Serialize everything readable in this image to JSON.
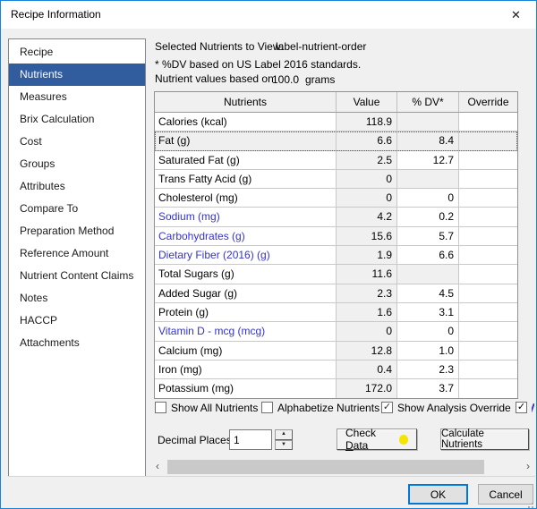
{
  "window": {
    "title": "Recipe Information"
  },
  "icons": {
    "close": "✕",
    "spinner_up": "▲",
    "spinner_down": "▼",
    "scroll_left": "‹",
    "scroll_right": "›",
    "check": "✓"
  },
  "colors": {
    "accent": "#0078d7",
    "sidebar_selection": "#315c9e",
    "nutrient_link_blue": "#3333cc",
    "check_data_dot": "#f5e400",
    "dialog_bg": "#f0f0f0"
  },
  "sidebar": {
    "items": [
      {
        "label": "Recipe",
        "selected": false
      },
      {
        "label": "Nutrients",
        "selected": true
      },
      {
        "label": "Measures",
        "selected": false
      },
      {
        "label": "Brix Calculation",
        "selected": false
      },
      {
        "label": "Cost",
        "selected": false
      },
      {
        "label": "Groups",
        "selected": false
      },
      {
        "label": "Attributes",
        "selected": false
      },
      {
        "label": "Compare To",
        "selected": false
      },
      {
        "label": "Preparation Method",
        "selected": false
      },
      {
        "label": "Reference Amount",
        "selected": false
      },
      {
        "label": "Nutrient Content Claims",
        "selected": false
      },
      {
        "label": "Notes",
        "selected": false
      },
      {
        "label": "HACCP",
        "selected": false
      },
      {
        "label": "Attachments",
        "selected": false
      }
    ]
  },
  "info": {
    "selected_nutrients_label": "Selected Nutrients to View:",
    "selected_nutrients_value": "label-nutrient-order",
    "dv_note": "* %DV based on US Label 2016 standards.",
    "basis_label": "Nutrient values based on",
    "basis_value": "100.0",
    "basis_unit": "grams"
  },
  "table": {
    "columns": [
      "Nutrients",
      "Value",
      "% DV*",
      "Override"
    ],
    "rows": [
      {
        "name": "Calories (kcal)",
        "value": "118.9",
        "dv": "",
        "override": "",
        "blue": false,
        "dv_na": true,
        "focused": false
      },
      {
        "name": "Fat (g)",
        "value": "6.6",
        "dv": "8.4",
        "override": "",
        "blue": false,
        "dv_na": false,
        "focused": true
      },
      {
        "name": "Saturated Fat (g)",
        "value": "2.5",
        "dv": "12.7",
        "override": "",
        "blue": false,
        "dv_na": false,
        "focused": false
      },
      {
        "name": "Trans Fatty Acid (g)",
        "value": "0",
        "dv": "",
        "override": "",
        "blue": false,
        "dv_na": true,
        "focused": false
      },
      {
        "name": "Cholesterol (mg)",
        "value": "0",
        "dv": "0",
        "override": "",
        "blue": false,
        "dv_na": false,
        "focused": false
      },
      {
        "name": "Sodium (mg)",
        "value": "4.2",
        "dv": "0.2",
        "override": "",
        "blue": true,
        "dv_na": false,
        "focused": false
      },
      {
        "name": "Carbohydrates (g)",
        "value": "15.6",
        "dv": "5.7",
        "override": "",
        "blue": true,
        "dv_na": false,
        "focused": false
      },
      {
        "name": "Dietary Fiber (2016) (g)",
        "value": "1.9",
        "dv": "6.6",
        "override": "",
        "blue": true,
        "dv_na": false,
        "focused": false
      },
      {
        "name": "Total Sugars (g)",
        "value": "11.6",
        "dv": "",
        "override": "",
        "blue": false,
        "dv_na": true,
        "focused": false
      },
      {
        "name": "Added Sugar (g)",
        "value": "2.3",
        "dv": "4.5",
        "override": "",
        "blue": false,
        "dv_na": false,
        "focused": false
      },
      {
        "name": "Protein (g)",
        "value": "1.6",
        "dv": "3.1",
        "override": "",
        "blue": false,
        "dv_na": false,
        "focused": false
      },
      {
        "name": "Vitamin D - mcg (mcg)",
        "value": "0",
        "dv": "0",
        "override": "",
        "blue": true,
        "dv_na": false,
        "focused": false
      },
      {
        "name": "Calcium (mg)",
        "value": "12.8",
        "dv": "1.0",
        "override": "",
        "blue": false,
        "dv_na": false,
        "focused": false
      },
      {
        "name": "Iron (mg)",
        "value": "0.4",
        "dv": "2.3",
        "override": "",
        "blue": false,
        "dv_na": false,
        "focused": false
      },
      {
        "name": "Potassium (mg)",
        "value": "172.0",
        "dv": "3.7",
        "override": "",
        "blue": false,
        "dv_na": false,
        "focused": false
      }
    ]
  },
  "checkboxes": [
    {
      "label": "Show All Nutrients",
      "checked": false,
      "clipped": false
    },
    {
      "label": "Alphabetize Nutrients",
      "checked": false,
      "clipped": false
    },
    {
      "label": "Show Analysis Override",
      "checked": true,
      "clipped": false
    },
    {
      "label": "",
      "checked": true,
      "clipped": true
    }
  ],
  "controls": {
    "decimal_places_label": "Decimal Places:",
    "decimal_places_value": "1",
    "check_data_pre": "Check ",
    "check_data_mnemonic": "D",
    "check_data_post": "ata",
    "calculate_label": "Calculate Nutrients"
  },
  "footer": {
    "ok": "OK",
    "cancel": "Cancel"
  }
}
